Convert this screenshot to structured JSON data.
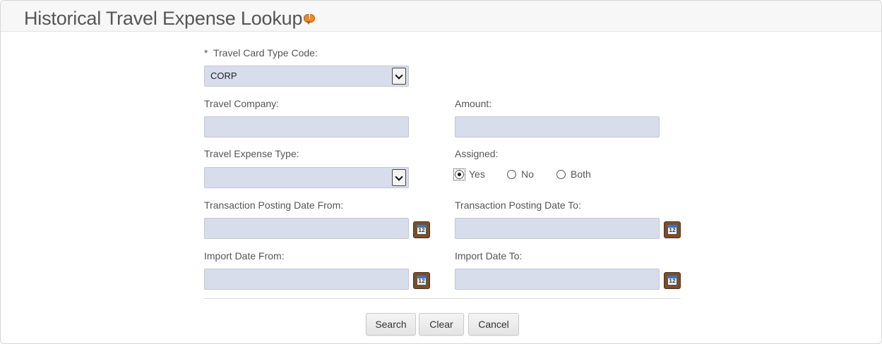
{
  "header": {
    "title": "Historical Travel Expense Lookup",
    "help_icon": "help-bubble-icon"
  },
  "form": {
    "card_type": {
      "required_mark": "*",
      "label": "Travel Card Type Code:",
      "value": "CORP"
    },
    "travel_company": {
      "label": "Travel Company:",
      "value": ""
    },
    "amount": {
      "label": "Amount:",
      "value": ""
    },
    "expense_type": {
      "label": "Travel Expense Type:",
      "value": ""
    },
    "assigned": {
      "label": "Assigned:",
      "options": [
        "Yes",
        "No",
        "Both"
      ],
      "selected": "Yes"
    },
    "posting_date_from": {
      "label": "Transaction Posting Date From:",
      "value": ""
    },
    "posting_date_to": {
      "label": "Transaction Posting Date To:",
      "value": ""
    },
    "import_date_from": {
      "label": "Import Date From:",
      "value": ""
    },
    "import_date_to": {
      "label": "Import Date To:",
      "value": ""
    },
    "calendar_icon": {
      "name": "calendar-icon",
      "day": "12"
    }
  },
  "buttons": {
    "search": "Search",
    "clear": "Clear",
    "cancel": "Cancel"
  },
  "colors": {
    "field_background": "#d8ddec",
    "help_icon": "#e8892a",
    "calendar_icon": "#7a4e2b"
  }
}
